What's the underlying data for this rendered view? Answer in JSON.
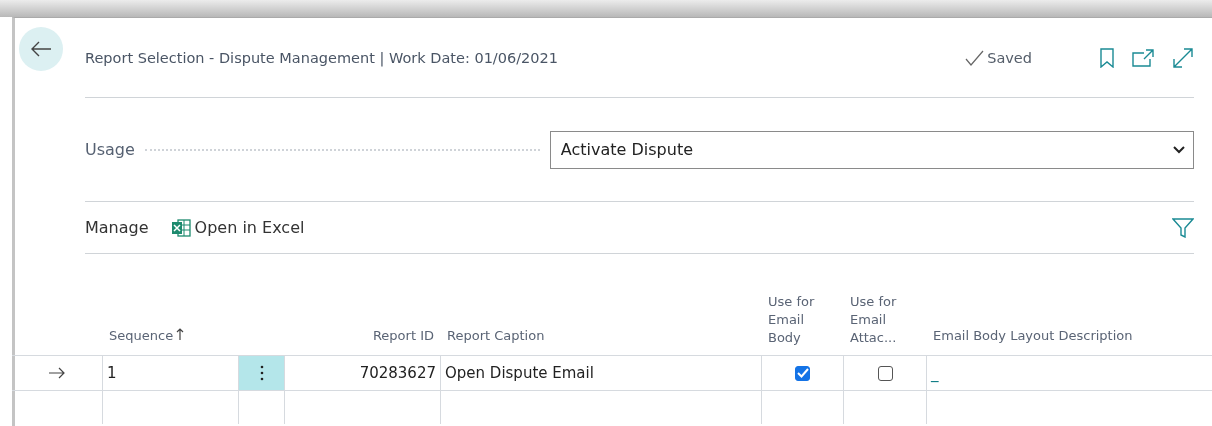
{
  "page": {
    "title": "Report Selection - Dispute Management | Work Date: 01/06/2021",
    "save_status": "Saved"
  },
  "usage": {
    "label": "Usage",
    "value": "Activate Dispute"
  },
  "action_bar": {
    "items": [
      {
        "kind": "text",
        "label": "Manage"
      },
      {
        "kind": "excel",
        "label": "Open in Excel"
      }
    ]
  },
  "table": {
    "columns": [
      {
        "label": "Sequence",
        "sorted": true
      },
      {
        "label": "Report ID",
        "sorted": false
      },
      {
        "label": "Report Caption",
        "sorted": false
      },
      {
        "label": "Use for Email Body",
        "sorted": false
      },
      {
        "label": "Use for Email Attac...",
        "sorted": false
      },
      {
        "label": "Email Body Layout Description",
        "sorted": false
      }
    ],
    "rows": [
      {
        "current": true,
        "sequence": "1",
        "report_id": "70283627",
        "report_caption": "Open Dispute Email",
        "use_for_email_body": true,
        "use_for_email_attachment": false,
        "email_body_layout_description": "_"
      }
    ]
  }
}
